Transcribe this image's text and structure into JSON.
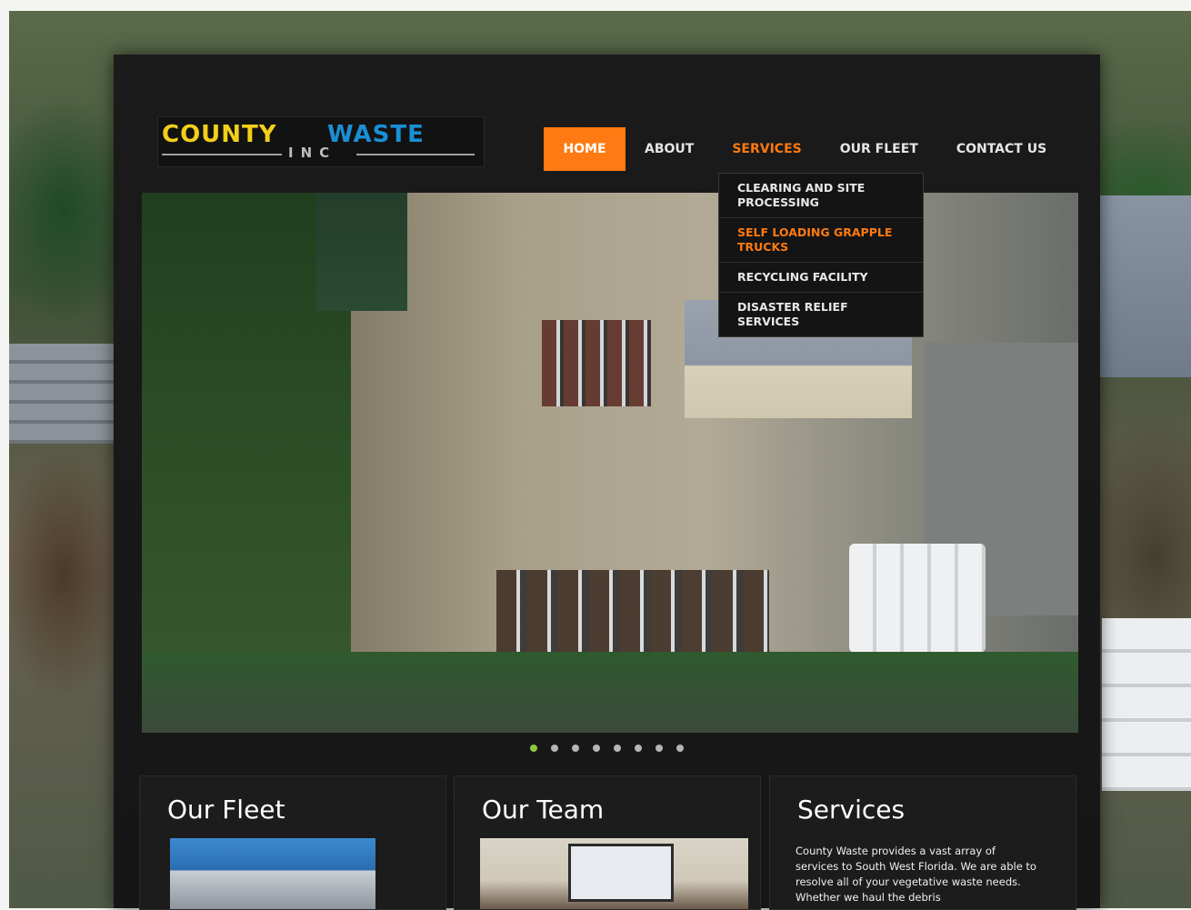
{
  "brand": {
    "name_part1": "COUNTY",
    "name_part2": "WASTE",
    "suffix": "INC",
    "colors": {
      "yellow": "#f2cf1a",
      "blue": "#1a8fd4"
    }
  },
  "nav": {
    "items": [
      {
        "label": "HOME"
      },
      {
        "label": "ABOUT"
      },
      {
        "label": "SERVICES"
      },
      {
        "label": "OUR FLEET"
      },
      {
        "label": "CONTACT US"
      }
    ],
    "accent_color": "#ff7a12"
  },
  "services_menu": {
    "items": [
      {
        "label": "CLEARING AND SITE PROCESSING"
      },
      {
        "label": "SELF LOADING GRAPPLE TRUCKS"
      },
      {
        "label": "RECYCLING FACILITY"
      },
      {
        "label": "DISASTER RELIEF SERVICES"
      }
    ]
  },
  "slider": {
    "active_index": 0,
    "total": 8,
    "active_color": "#8ec63f"
  },
  "cards": {
    "fleet": {
      "title": "Our Fleet"
    },
    "team": {
      "title": "Our Team"
    },
    "services": {
      "title": "Services",
      "text": "County Waste provides a vast array of services to South West Florida.  We are able to resolve all of your vegetative waste needs. Whether we haul the debris"
    }
  }
}
